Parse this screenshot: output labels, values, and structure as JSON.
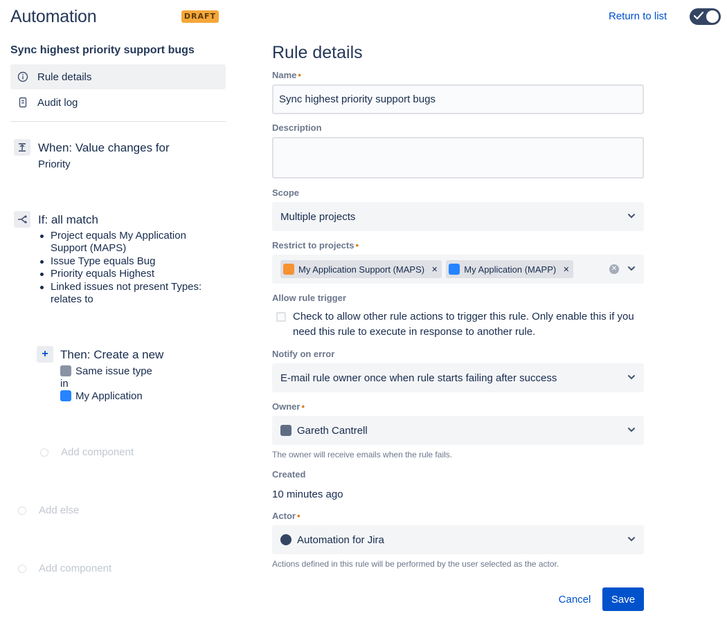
{
  "header": {
    "app_title": "Automation",
    "status_badge": "DRAFT",
    "return_link": "Return to list",
    "toggle_enabled": true
  },
  "sidebar": {
    "rule_name": "Sync highest priority support bugs",
    "nav_items": [
      {
        "label": "Rule details",
        "icon": "info-icon",
        "active": true
      },
      {
        "label": "Audit log",
        "icon": "document-icon",
        "active": false
      }
    ],
    "trigger": {
      "title": "When: Value changes for",
      "detail": "Priority"
    },
    "condition": {
      "title": "If: all match",
      "items": [
        "Project equals My Application Support (MAPS)",
        "Issue Type equals Bug",
        "Priority equals Highest",
        "Linked issues not present Types: relates to"
      ]
    },
    "action": {
      "title": "Then: Create a new",
      "issue_type": "Same issue type",
      "connector": "in",
      "project": "My Application"
    },
    "add_component_1": "Add component",
    "add_else": "Add else",
    "add_component_2": "Add component"
  },
  "form": {
    "heading": "Rule details",
    "name": {
      "label": "Name",
      "value": "Sync highest priority support bugs"
    },
    "description": {
      "label": "Description",
      "value": ""
    },
    "scope": {
      "label": "Scope",
      "value": "Multiple projects"
    },
    "restrict": {
      "label": "Restrict to projects",
      "tags": [
        {
          "label": "My Application Support (MAPS)",
          "color": "#f79232"
        },
        {
          "label": "My Application (MAPP)",
          "color": "#2684ff"
        }
      ]
    },
    "allow_trigger": {
      "label": "Allow rule trigger",
      "checkbox_text": "Check to allow other rule actions to trigger this rule. Only enable this if you need this rule to execute in response to another rule.",
      "checked": false
    },
    "notify": {
      "label": "Notify on error",
      "value": "E-mail rule owner once when rule starts failing after success"
    },
    "owner": {
      "label": "Owner",
      "value": "Gareth Cantrell",
      "helper": "The owner will receive emails when the rule fails."
    },
    "created": {
      "label": "Created",
      "value": "10 minutes ago"
    },
    "actor": {
      "label": "Actor",
      "value": "Automation for Jira",
      "helper": "Actions defined in this rule will be performed by the user selected as the actor."
    },
    "cancel_label": "Cancel",
    "save_label": "Save"
  },
  "colors": {
    "accent": "#0052cc",
    "draft": "#f4a73a",
    "required": "#de7a17",
    "toggle": "#344563"
  }
}
